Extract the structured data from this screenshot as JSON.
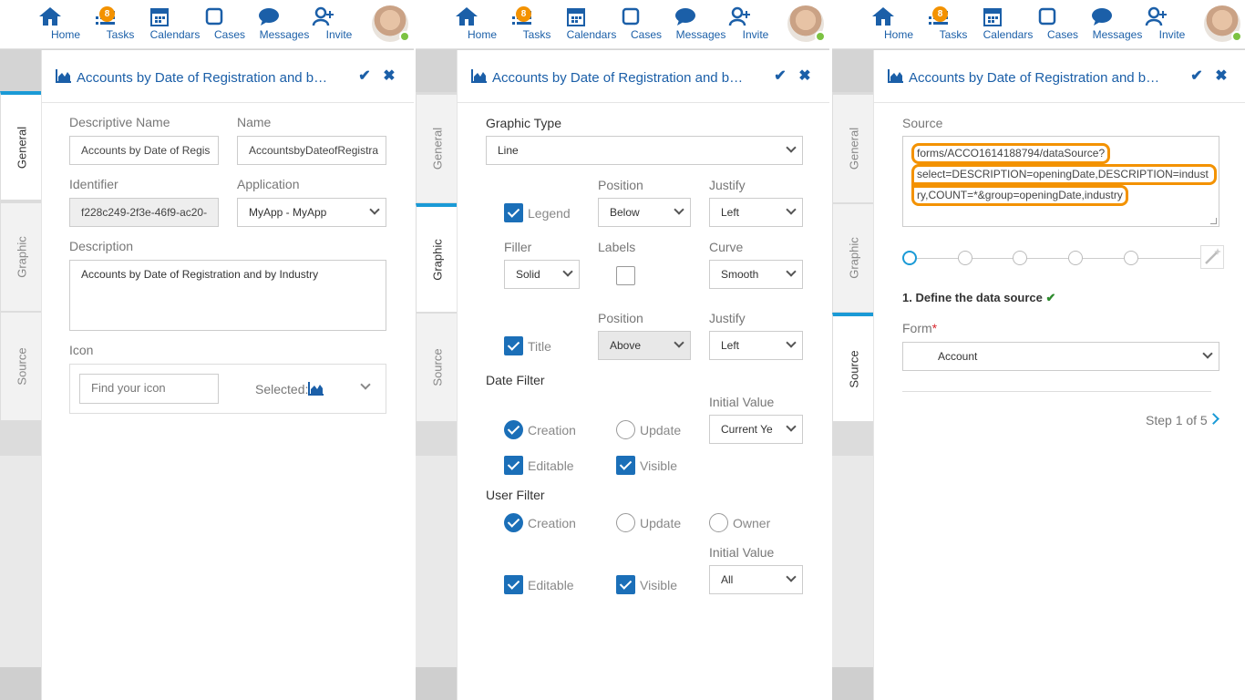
{
  "nav": {
    "items": [
      {
        "label": "Home",
        "icon": "home-icon"
      },
      {
        "label": "Tasks",
        "icon": "tasks-icon",
        "badge": "8"
      },
      {
        "label": "Calendars",
        "icon": "calendar-icon"
      },
      {
        "label": "Cases",
        "icon": "cases-icon"
      },
      {
        "label": "Messages",
        "icon": "messages-icon"
      },
      {
        "label": "Invite",
        "icon": "invite-icon"
      }
    ],
    "accent": "#1b5fa8",
    "badge_color": "#f39200"
  },
  "tabs": {
    "general": "General",
    "graphic": "Graphic",
    "source": "Source"
  },
  "panel_title": "Accounts by Date of Registration and b…",
  "general": {
    "descriptive_name_label": "Descriptive Name",
    "descriptive_name_value": "Accounts by Date of Regis",
    "name_label": "Name",
    "name_value": "AccountsbyDateofRegistra",
    "identifier_label": "Identifier",
    "identifier_value": "f228c249-2f3e-46f9-ac20-",
    "application_label": "Application",
    "application_value": "MyApp - MyApp",
    "description_label": "Description",
    "description_value": "Accounts by Date of Registration and by Industry",
    "icon_label": "Icon",
    "icon_search_placeholder": "Find your icon",
    "icon_selected_label": "Selected:"
  },
  "graphic": {
    "graphic_type_label": "Graphic Type",
    "graphic_type_value": "Line",
    "legend_label": "Legend",
    "position_label": "Position",
    "legend_position": "Below",
    "justify_label": "Justify",
    "legend_justify": "Left",
    "filler_label": "Filler",
    "filler_value": "Solid",
    "labels_label": "Labels",
    "curve_label": "Curve",
    "curve_value": "Smooth",
    "title_label": "Title",
    "title_position": "Above",
    "title_justify": "Left",
    "date_filter_label": "Date Filter",
    "initial_value_label": "Initial Value",
    "date_initial_value": "Current Ye",
    "creation_label": "Creation",
    "update_label": "Update",
    "editable_label": "Editable",
    "visible_label": "Visible",
    "user_filter_label": "User Filter",
    "owner_label": "Owner",
    "user_initial_value": "All"
  },
  "source": {
    "source_label": "Source",
    "source_line1": "forms/ACCO1614188794/dataSource?",
    "source_line2": "select=DESCRIPTION=openingDate,DESCRIPTION=indust",
    "source_line3": "ry,COUNT=*&group=openingDate,industry",
    "step_title": "1. Define the data source",
    "form_label": "Form",
    "form_required": "*",
    "form_value": "Account",
    "step_counter": "Step 1 of 5"
  }
}
